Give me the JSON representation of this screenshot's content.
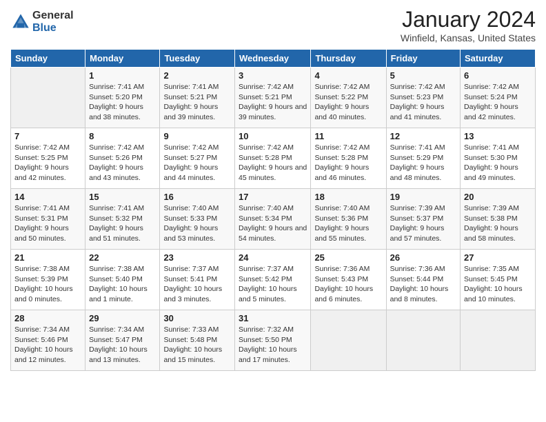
{
  "logo": {
    "general": "General",
    "blue": "Blue"
  },
  "header": {
    "title": "January 2024",
    "location": "Winfield, Kansas, United States"
  },
  "days": [
    "Sunday",
    "Monday",
    "Tuesday",
    "Wednesday",
    "Thursday",
    "Friday",
    "Saturday"
  ],
  "weeks": [
    [
      {
        "num": "",
        "empty": true
      },
      {
        "num": "1",
        "sunrise": "Sunrise: 7:41 AM",
        "sunset": "Sunset: 5:20 PM",
        "daylight": "Daylight: 9 hours and 38 minutes."
      },
      {
        "num": "2",
        "sunrise": "Sunrise: 7:41 AM",
        "sunset": "Sunset: 5:21 PM",
        "daylight": "Daylight: 9 hours and 39 minutes."
      },
      {
        "num": "3",
        "sunrise": "Sunrise: 7:42 AM",
        "sunset": "Sunset: 5:21 PM",
        "daylight": "Daylight: 9 hours and 39 minutes."
      },
      {
        "num": "4",
        "sunrise": "Sunrise: 7:42 AM",
        "sunset": "Sunset: 5:22 PM",
        "daylight": "Daylight: 9 hours and 40 minutes."
      },
      {
        "num": "5",
        "sunrise": "Sunrise: 7:42 AM",
        "sunset": "Sunset: 5:23 PM",
        "daylight": "Daylight: 9 hours and 41 minutes."
      },
      {
        "num": "6",
        "sunrise": "Sunrise: 7:42 AM",
        "sunset": "Sunset: 5:24 PM",
        "daylight": "Daylight: 9 hours and 42 minutes."
      }
    ],
    [
      {
        "num": "7",
        "sunrise": "Sunrise: 7:42 AM",
        "sunset": "Sunset: 5:25 PM",
        "daylight": "Daylight: 9 hours and 42 minutes."
      },
      {
        "num": "8",
        "sunrise": "Sunrise: 7:42 AM",
        "sunset": "Sunset: 5:26 PM",
        "daylight": "Daylight: 9 hours and 43 minutes."
      },
      {
        "num": "9",
        "sunrise": "Sunrise: 7:42 AM",
        "sunset": "Sunset: 5:27 PM",
        "daylight": "Daylight: 9 hours and 44 minutes."
      },
      {
        "num": "10",
        "sunrise": "Sunrise: 7:42 AM",
        "sunset": "Sunset: 5:28 PM",
        "daylight": "Daylight: 9 hours and 45 minutes."
      },
      {
        "num": "11",
        "sunrise": "Sunrise: 7:42 AM",
        "sunset": "Sunset: 5:28 PM",
        "daylight": "Daylight: 9 hours and 46 minutes."
      },
      {
        "num": "12",
        "sunrise": "Sunrise: 7:41 AM",
        "sunset": "Sunset: 5:29 PM",
        "daylight": "Daylight: 9 hours and 48 minutes."
      },
      {
        "num": "13",
        "sunrise": "Sunrise: 7:41 AM",
        "sunset": "Sunset: 5:30 PM",
        "daylight": "Daylight: 9 hours and 49 minutes."
      }
    ],
    [
      {
        "num": "14",
        "sunrise": "Sunrise: 7:41 AM",
        "sunset": "Sunset: 5:31 PM",
        "daylight": "Daylight: 9 hours and 50 minutes."
      },
      {
        "num": "15",
        "sunrise": "Sunrise: 7:41 AM",
        "sunset": "Sunset: 5:32 PM",
        "daylight": "Daylight: 9 hours and 51 minutes."
      },
      {
        "num": "16",
        "sunrise": "Sunrise: 7:40 AM",
        "sunset": "Sunset: 5:33 PM",
        "daylight": "Daylight: 9 hours and 53 minutes."
      },
      {
        "num": "17",
        "sunrise": "Sunrise: 7:40 AM",
        "sunset": "Sunset: 5:34 PM",
        "daylight": "Daylight: 9 hours and 54 minutes."
      },
      {
        "num": "18",
        "sunrise": "Sunrise: 7:40 AM",
        "sunset": "Sunset: 5:36 PM",
        "daylight": "Daylight: 9 hours and 55 minutes."
      },
      {
        "num": "19",
        "sunrise": "Sunrise: 7:39 AM",
        "sunset": "Sunset: 5:37 PM",
        "daylight": "Daylight: 9 hours and 57 minutes."
      },
      {
        "num": "20",
        "sunrise": "Sunrise: 7:39 AM",
        "sunset": "Sunset: 5:38 PM",
        "daylight": "Daylight: 9 hours and 58 minutes."
      }
    ],
    [
      {
        "num": "21",
        "sunrise": "Sunrise: 7:38 AM",
        "sunset": "Sunset: 5:39 PM",
        "daylight": "Daylight: 10 hours and 0 minutes."
      },
      {
        "num": "22",
        "sunrise": "Sunrise: 7:38 AM",
        "sunset": "Sunset: 5:40 PM",
        "daylight": "Daylight: 10 hours and 1 minute."
      },
      {
        "num": "23",
        "sunrise": "Sunrise: 7:37 AM",
        "sunset": "Sunset: 5:41 PM",
        "daylight": "Daylight: 10 hours and 3 minutes."
      },
      {
        "num": "24",
        "sunrise": "Sunrise: 7:37 AM",
        "sunset": "Sunset: 5:42 PM",
        "daylight": "Daylight: 10 hours and 5 minutes."
      },
      {
        "num": "25",
        "sunrise": "Sunrise: 7:36 AM",
        "sunset": "Sunset: 5:43 PM",
        "daylight": "Daylight: 10 hours and 6 minutes."
      },
      {
        "num": "26",
        "sunrise": "Sunrise: 7:36 AM",
        "sunset": "Sunset: 5:44 PM",
        "daylight": "Daylight: 10 hours and 8 minutes."
      },
      {
        "num": "27",
        "sunrise": "Sunrise: 7:35 AM",
        "sunset": "Sunset: 5:45 PM",
        "daylight": "Daylight: 10 hours and 10 minutes."
      }
    ],
    [
      {
        "num": "28",
        "sunrise": "Sunrise: 7:34 AM",
        "sunset": "Sunset: 5:46 PM",
        "daylight": "Daylight: 10 hours and 12 minutes."
      },
      {
        "num": "29",
        "sunrise": "Sunrise: 7:34 AM",
        "sunset": "Sunset: 5:47 PM",
        "daylight": "Daylight: 10 hours and 13 minutes."
      },
      {
        "num": "30",
        "sunrise": "Sunrise: 7:33 AM",
        "sunset": "Sunset: 5:48 PM",
        "daylight": "Daylight: 10 hours and 15 minutes."
      },
      {
        "num": "31",
        "sunrise": "Sunrise: 7:32 AM",
        "sunset": "Sunset: 5:50 PM",
        "daylight": "Daylight: 10 hours and 17 minutes."
      },
      {
        "num": "",
        "empty": true
      },
      {
        "num": "",
        "empty": true
      },
      {
        "num": "",
        "empty": true
      }
    ]
  ]
}
